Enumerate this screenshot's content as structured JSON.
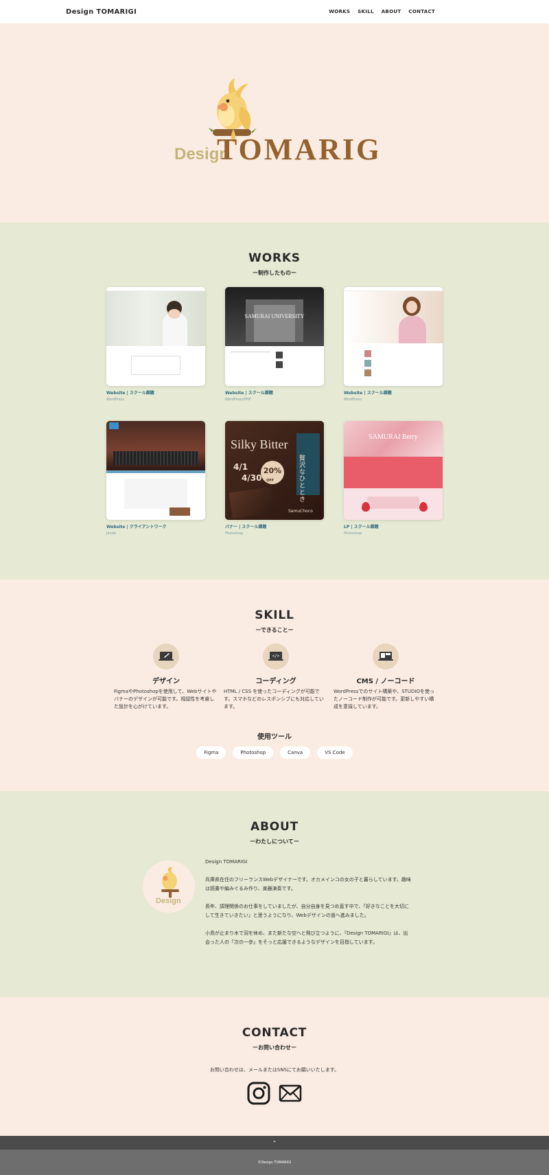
{
  "header": {
    "site_title": "Design TOMARIGI",
    "nav": [
      "WORKS",
      "SKILL",
      "ABOUT",
      "CONTACT"
    ]
  },
  "hero": {
    "logo_small": "Design",
    "logo_large": "TOMARIGI"
  },
  "works": {
    "title": "WORKS",
    "subtitle": "ー制作したものー",
    "items": [
      {
        "category": "Website",
        "label": "スクール課題",
        "tech": "WordPress"
      },
      {
        "category": "Website",
        "label": "スクール課題",
        "tech": "WordPress/PHP"
      },
      {
        "category": "Website",
        "label": "スクール課題",
        "tech": "WordPress"
      },
      {
        "category": "Website",
        "label": "クライアントワーク",
        "tech": "Jimdo"
      },
      {
        "category": "バナー",
        "label": "スクール課題",
        "tech": "Photoshop"
      },
      {
        "category": "LP",
        "label": "スクール課題",
        "tech": "Photoshop"
      }
    ],
    "thumb_text": {
      "banner_title": "Silky Bitter",
      "banner_date1": "4/1",
      "banner_date2": "4/30",
      "banner_pct": "20%",
      "banner_off": "OFF",
      "banner_jp": "贅沢なひととき",
      "banner_brand": "SamuChoco",
      "lp_title": "SAMURAI Berry",
      "univ_title": "SAMURAI UNIVERSITY"
    }
  },
  "skill": {
    "title": "SKILL",
    "subtitle": "ーできることー",
    "items": [
      {
        "name": "デザイン",
        "desc": "FigmaやPhotoshopを使用して、Webサイトやバナーのデザインが可能です。視認性を考慮した設計を心がけています。"
      },
      {
        "name": "コーディング",
        "desc": "HTML / CSS を使ったコーディングが可能です。スマホなどのレスポンシブにも対応しています。"
      },
      {
        "name": "CMS / ノーコード",
        "desc": "WordPressでのサイト構築や、STUDIOを使ったノーコード制作が可能です。更新しやすい構成を意識しています。"
      }
    ],
    "tools_title": "使用ツール",
    "tools": [
      "Figma",
      "Photoshop",
      "Canva",
      "VS Code"
    ]
  },
  "about": {
    "title": "ABOUT",
    "subtitle": "ーわたしについてー",
    "name": "Design TOMARIGI",
    "p1": "兵庫県在住のフリーランスWebデザイナーです。オカメインコの女の子と暮らしています。趣味は読書や編みぐるみ作り、楽器演奏です。",
    "p2": "長年、調理関係のお仕事をしていましたが、自分自身を見つめ直す中で、「好きなことを大切にして生きていきたい」と思うようになり、Webデザインの道へ進みました。",
    "p3": "小鳥が止まり木で羽を休め、また新たな空へと飛び立つように、『Design TOMARIGI』は、出会った人の「次の一歩」をそっと応援できるようなデザインを目指しています。",
    "avatar_text": "Design"
  },
  "contact": {
    "title": "CONTACT",
    "subtitle": "ーお問い合わせー",
    "text": "お問い合わせは、メールまたはSNSにてお願いいたします。"
  },
  "footer": {
    "to_top": "⌃",
    "copyright": "©Design TOMARIGI"
  }
}
